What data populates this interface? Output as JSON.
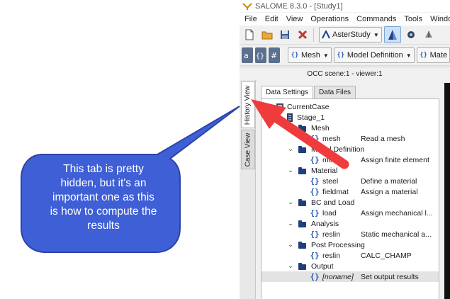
{
  "window": {
    "title": "SALOME 8.3.0 - [Study1]"
  },
  "menu": [
    "File",
    "Edit",
    "View",
    "Operations",
    "Commands",
    "Tools",
    "Window"
  ],
  "toolbar1": {
    "module_combo": "AsterStudy"
  },
  "toolbar2": {
    "combos": [
      "Mesh",
      "Model Definition",
      "Mate"
    ]
  },
  "viewer": {
    "status": "OCC scene:1 - viewer:1"
  },
  "side_tabs": [
    "History View",
    "Case View"
  ],
  "panel_tabs": [
    "Data Settings",
    "Data Files"
  ],
  "tree": [
    {
      "label": "CurrentCase",
      "desc": "",
      "expander": "",
      "icon": "case-icon"
    },
    {
      "label": "Stage_1",
      "desc": "",
      "expander": "⌄",
      "icon": "stage-icon"
    },
    {
      "label": "Mesh",
      "desc": "",
      "expander": "",
      "icon": "folder-icon"
    },
    {
      "label": "mesh",
      "desc": "Read a mesh",
      "expander": "",
      "icon": "command-icon"
    },
    {
      "label": "Model Definition",
      "desc": "",
      "expander": "⌄",
      "icon": "folder-icon"
    },
    {
      "label": "model",
      "desc": "Assign finite element",
      "expander": "",
      "icon": "command-icon"
    },
    {
      "label": "Material",
      "desc": "",
      "expander": "⌄",
      "icon": "folder-icon"
    },
    {
      "label": "steel",
      "desc": "Define a material",
      "expander": "",
      "icon": "command-icon"
    },
    {
      "label": "fieldmat",
      "desc": "Assign a material",
      "expander": "",
      "icon": "command-icon"
    },
    {
      "label": "BC and Load",
      "desc": "",
      "expander": "⌄",
      "icon": "folder-icon"
    },
    {
      "label": "load",
      "desc": "Assign mechanical l...",
      "expander": "",
      "icon": "command-icon"
    },
    {
      "label": "Analysis",
      "desc": "",
      "expander": "⌄",
      "icon": "folder-icon"
    },
    {
      "label": "reslin",
      "desc": "Static mechanical a...",
      "expander": "",
      "icon": "command-icon"
    },
    {
      "label": "Post Processing",
      "desc": "",
      "expander": "⌄",
      "icon": "folder-icon"
    },
    {
      "label": "reslin",
      "desc": "CALC_CHAMP",
      "expander": "",
      "icon": "command-icon"
    },
    {
      "label": "Output",
      "desc": "",
      "expander": "⌄",
      "icon": "folder-icon"
    },
    {
      "label": "[noname]",
      "desc": "Set output results",
      "expander": "",
      "icon": "command-icon"
    }
  ],
  "callout": {
    "lines": [
      "This tab is pretty",
      "hidden, but it's an",
      "important one as this",
      "is how to compute the",
      "results"
    ]
  },
  "colors": {
    "callout_fill": "#3f5fd6",
    "arrow": "#ef3b3b",
    "folder": "#1f3f7a",
    "brace": "#2a5bb5"
  }
}
